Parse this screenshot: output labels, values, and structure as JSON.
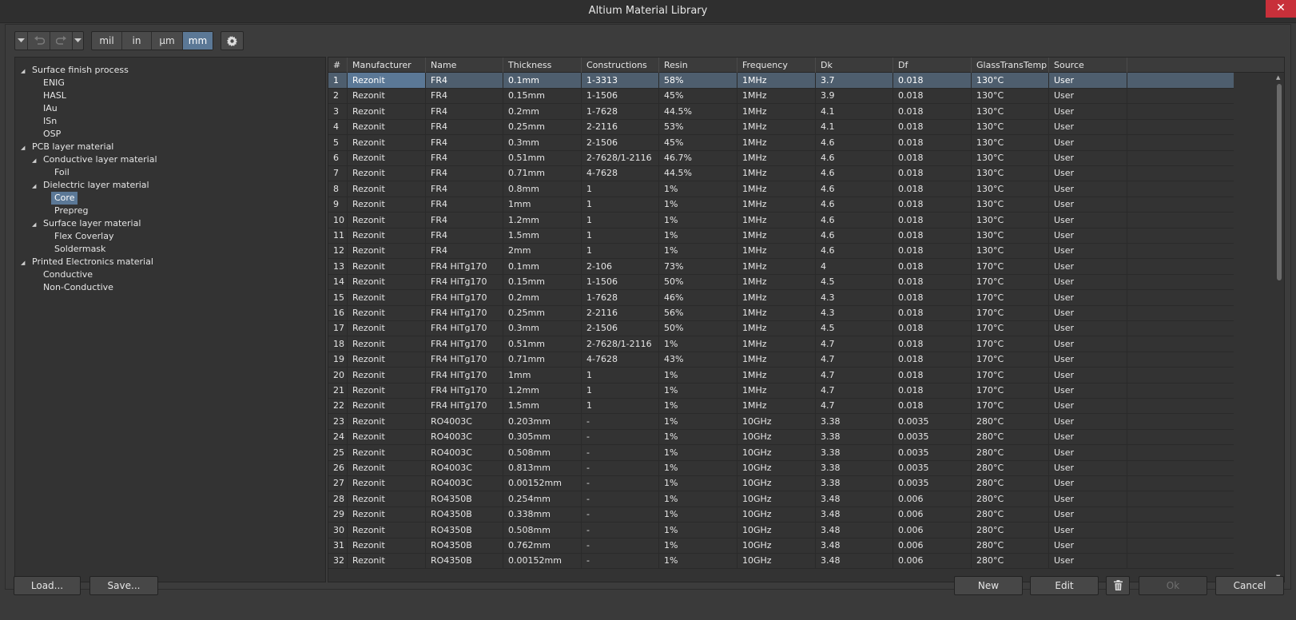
{
  "window": {
    "title": "Altium Material Library",
    "close_glyph": "✕"
  },
  "toolbar": {
    "units": [
      {
        "label": "mil",
        "active": false
      },
      {
        "label": "in",
        "active": false
      },
      {
        "label": "μm",
        "active": false
      },
      {
        "label": "mm",
        "active": true
      }
    ]
  },
  "tree": [
    {
      "label": "Surface finish process",
      "level": 0,
      "expanded": true
    },
    {
      "label": "ENIG",
      "level": 1
    },
    {
      "label": "HASL",
      "level": 1
    },
    {
      "label": "IAu",
      "level": 1
    },
    {
      "label": "ISn",
      "level": 1
    },
    {
      "label": "OSP",
      "level": 1
    },
    {
      "label": "PCB layer material",
      "level": 0,
      "expanded": true
    },
    {
      "label": "Conductive layer material",
      "level": 1,
      "expanded": true
    },
    {
      "label": "Foil",
      "level": 2
    },
    {
      "label": "Dielectric layer material",
      "level": 1,
      "expanded": true
    },
    {
      "label": "Core",
      "level": 2,
      "selected": true
    },
    {
      "label": "Prepreg",
      "level": 2
    },
    {
      "label": "Surface layer material",
      "level": 1,
      "expanded": true
    },
    {
      "label": "Flex Coverlay",
      "level": 2
    },
    {
      "label": "Soldermask",
      "level": 2
    },
    {
      "label": "Printed Electronics material",
      "level": 0,
      "expanded": true
    },
    {
      "label": "Conductive",
      "level": 1
    },
    {
      "label": "Non-Conductive",
      "level": 1
    }
  ],
  "table": {
    "columns": [
      "#",
      "Manufacturer",
      "Name",
      "Thickness",
      "Constructions",
      "Resin",
      "Frequency",
      "Dk",
      "Df",
      "GlassTransTemp",
      "Source"
    ],
    "rows": [
      [
        "1",
        "Rezonit",
        "FR4",
        "0.1mm",
        "1-3313",
        "58%",
        "1MHz",
        "3.7",
        "0.018",
        "130°C",
        "User"
      ],
      [
        "2",
        "Rezonit",
        "FR4",
        "0.15mm",
        "1-1506",
        "45%",
        "1MHz",
        "3.9",
        "0.018",
        "130°C",
        "User"
      ],
      [
        "3",
        "Rezonit",
        "FR4",
        "0.2mm",
        "1-7628",
        "44.5%",
        "1MHz",
        "4.1",
        "0.018",
        "130°C",
        "User"
      ],
      [
        "4",
        "Rezonit",
        "FR4",
        "0.25mm",
        "2-2116",
        "53%",
        "1MHz",
        "4.1",
        "0.018",
        "130°C",
        "User"
      ],
      [
        "5",
        "Rezonit",
        "FR4",
        "0.3mm",
        "2-1506",
        "45%",
        "1MHz",
        "4.6",
        "0.018",
        "130°C",
        "User"
      ],
      [
        "6",
        "Rezonit",
        "FR4",
        "0.51mm",
        "2-7628/1-2116",
        "46.7%",
        "1MHz",
        "4.6",
        "0.018",
        "130°C",
        "User"
      ],
      [
        "7",
        "Rezonit",
        "FR4",
        "0.71mm",
        "4-7628",
        "44.5%",
        "1MHz",
        "4.6",
        "0.018",
        "130°C",
        "User"
      ],
      [
        "8",
        "Rezonit",
        "FR4",
        "0.8mm",
        "1",
        "1%",
        "1MHz",
        "4.6",
        "0.018",
        "130°C",
        "User"
      ],
      [
        "9",
        "Rezonit",
        "FR4",
        "1mm",
        "1",
        "1%",
        "1MHz",
        "4.6",
        "0.018",
        "130°C",
        "User"
      ],
      [
        "10",
        "Rezonit",
        "FR4",
        "1.2mm",
        "1",
        "1%",
        "1MHz",
        "4.6",
        "0.018",
        "130°C",
        "User"
      ],
      [
        "11",
        "Rezonit",
        "FR4",
        "1.5mm",
        "1",
        "1%",
        "1MHz",
        "4.6",
        "0.018",
        "130°C",
        "User"
      ],
      [
        "12",
        "Rezonit",
        "FR4",
        "2mm",
        "1",
        "1%",
        "1MHz",
        "4.6",
        "0.018",
        "130°C",
        "User"
      ],
      [
        "13",
        "Rezonit",
        "FR4 HiTg170",
        "0.1mm",
        "2-106",
        "73%",
        "1MHz",
        "4",
        "0.018",
        "170°C",
        "User"
      ],
      [
        "14",
        "Rezonit",
        "FR4 HiTg170",
        "0.15mm",
        "1-1506",
        "50%",
        "1MHz",
        "4.5",
        "0.018",
        "170°C",
        "User"
      ],
      [
        "15",
        "Rezonit",
        "FR4 HiTg170",
        "0.2mm",
        "1-7628",
        "46%",
        "1MHz",
        "4.3",
        "0.018",
        "170°C",
        "User"
      ],
      [
        "16",
        "Rezonit",
        "FR4 HiTg170",
        "0.25mm",
        "2-2116",
        "56%",
        "1MHz",
        "4.3",
        "0.018",
        "170°C",
        "User"
      ],
      [
        "17",
        "Rezonit",
        "FR4 HiTg170",
        "0.3mm",
        "2-1506",
        "50%",
        "1MHz",
        "4.5",
        "0.018",
        "170°C",
        "User"
      ],
      [
        "18",
        "Rezonit",
        "FR4 HiTg170",
        "0.51mm",
        "2-7628/1-2116",
        "1%",
        "1MHz",
        "4.7",
        "0.018",
        "170°C",
        "User"
      ],
      [
        "19",
        "Rezonit",
        "FR4 HiTg170",
        "0.71mm",
        "4-7628",
        "43%",
        "1MHz",
        "4.7",
        "0.018",
        "170°C",
        "User"
      ],
      [
        "20",
        "Rezonit",
        "FR4 HiTg170",
        "1mm",
        "1",
        "1%",
        "1MHz",
        "4.7",
        "0.018",
        "170°C",
        "User"
      ],
      [
        "21",
        "Rezonit",
        "FR4 HiTg170",
        "1.2mm",
        "1",
        "1%",
        "1MHz",
        "4.7",
        "0.018",
        "170°C",
        "User"
      ],
      [
        "22",
        "Rezonit",
        "FR4 HiTg170",
        "1.5mm",
        "1",
        "1%",
        "1MHz",
        "4.7",
        "0.018",
        "170°C",
        "User"
      ],
      [
        "23",
        "Rezonit",
        "RO4003C",
        "0.203mm",
        "-",
        "1%",
        "10GHz",
        "3.38",
        "0.0035",
        "280°C",
        "User"
      ],
      [
        "24",
        "Rezonit",
        "RO4003C",
        "0.305mm",
        "-",
        "1%",
        "10GHz",
        "3.38",
        "0.0035",
        "280°C",
        "User"
      ],
      [
        "25",
        "Rezonit",
        "RO4003C",
        "0.508mm",
        "-",
        "1%",
        "10GHz",
        "3.38",
        "0.0035",
        "280°C",
        "User"
      ],
      [
        "26",
        "Rezonit",
        "RO4003C",
        "0.813mm",
        "-",
        "1%",
        "10GHz",
        "3.38",
        "0.0035",
        "280°C",
        "User"
      ],
      [
        "27",
        "Rezonit",
        "RO4003C",
        "0.00152mm",
        "-",
        "1%",
        "10GHz",
        "3.38",
        "0.0035",
        "280°C",
        "User"
      ],
      [
        "28",
        "Rezonit",
        "RO4350B",
        "0.254mm",
        "-",
        "1%",
        "10GHz",
        "3.48",
        "0.006",
        "280°C",
        "User"
      ],
      [
        "29",
        "Rezonit",
        "RO4350B",
        "0.338mm",
        "-",
        "1%",
        "10GHz",
        "3.48",
        "0.006",
        "280°C",
        "User"
      ],
      [
        "30",
        "Rezonit",
        "RO4350B",
        "0.508mm",
        "-",
        "1%",
        "10GHz",
        "3.48",
        "0.006",
        "280°C",
        "User"
      ],
      [
        "31",
        "Rezonit",
        "RO4350B",
        "0.762mm",
        "-",
        "1%",
        "10GHz",
        "3.48",
        "0.006",
        "280°C",
        "User"
      ],
      [
        "32",
        "Rezonit",
        "RO4350B",
        "0.00152mm",
        "-",
        "1%",
        "10GHz",
        "3.48",
        "0.006",
        "280°C",
        "User"
      ]
    ],
    "selected_row": 0
  },
  "buttons": {
    "load": "Load...",
    "save": "Save...",
    "new": "New",
    "edit": "Edit",
    "ok": "Ok",
    "cancel": "Cancel"
  },
  "colors": {
    "accent": "#5b7896",
    "close": "#c8303a"
  }
}
